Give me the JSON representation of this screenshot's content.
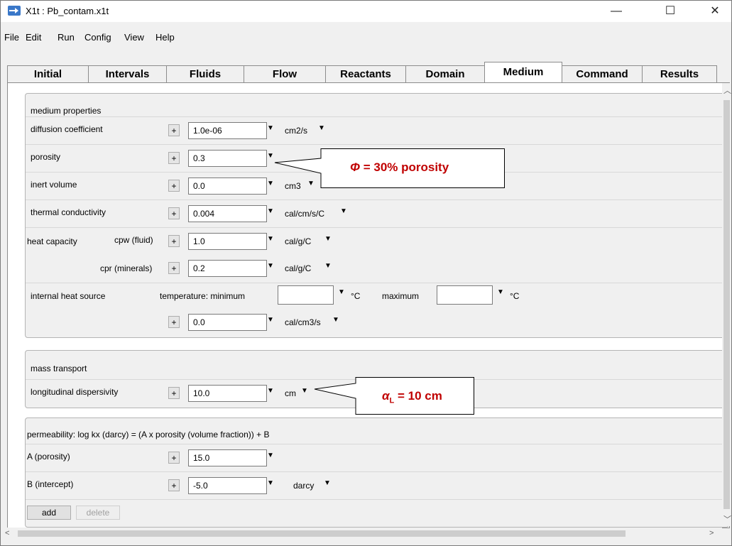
{
  "window": {
    "title": "X1t : Pb_contam.x1t",
    "minimize": "—",
    "maximize": "☐",
    "close": "✕"
  },
  "menu": [
    "File",
    "Edit",
    "Run",
    "Config",
    "View",
    "Help"
  ],
  "tabs": [
    "Initial",
    "Intervals",
    "Fluids",
    "Flow",
    "Reactants",
    "Domain",
    "Medium",
    "Command",
    "Results"
  ],
  "active_tab": "Medium",
  "medium_properties": {
    "header": "medium properties",
    "diffusion": {
      "label": "diffusion coefficient",
      "value": "1.0e-06",
      "unit": "cm2/s"
    },
    "porosity": {
      "label": "porosity",
      "value": "0.3"
    },
    "inert_volume": {
      "label": "inert volume",
      "value": "0.0",
      "unit": "cm3"
    },
    "thermal_conductivity": {
      "label": "thermal conductivity",
      "value": "0.004",
      "unit": "cal/cm/s/C"
    },
    "heat_capacity": {
      "label": "heat capacity",
      "cpw_label": "cpw (fluid)",
      "cpw_value": "1.0",
      "cpw_unit": "cal/g/C",
      "cpr_label": "cpr (minerals)",
      "cpr_value": "0.2",
      "cpr_unit": "cal/g/C"
    },
    "internal_heat": {
      "label": "internal heat source",
      "temp_label": "temperature:  minimum",
      "min_value": "",
      "min_unit": "°C",
      "max_label": "maximum",
      "max_value": "",
      "max_unit": "°C",
      "value": "0.0",
      "unit": "cal/cm3/s"
    }
  },
  "mass_transport": {
    "header": "mass transport",
    "dispersivity": {
      "label": "longitudinal dispersivity",
      "value": "10.0",
      "unit": "cm"
    }
  },
  "permeability": {
    "header": "permeability:  log kx (darcy) = (A x porosity (volume fraction)) + B",
    "a": {
      "label": "A (porosity)",
      "value": "15.0"
    },
    "b": {
      "label": "B (intercept)",
      "value": "-5.0",
      "unit": "darcy"
    },
    "add_label": "add",
    "delete_label": "delete"
  },
  "callouts": {
    "porosity_symbol": "Φ",
    "porosity_text": " = 30% porosity",
    "dispersivity_symbol": "α",
    "dispersivity_sub": "L",
    "dispersivity_text": " = 10 cm"
  },
  "colors": {
    "callout_text": "#c00000",
    "app_icon": "#3a78c9"
  }
}
